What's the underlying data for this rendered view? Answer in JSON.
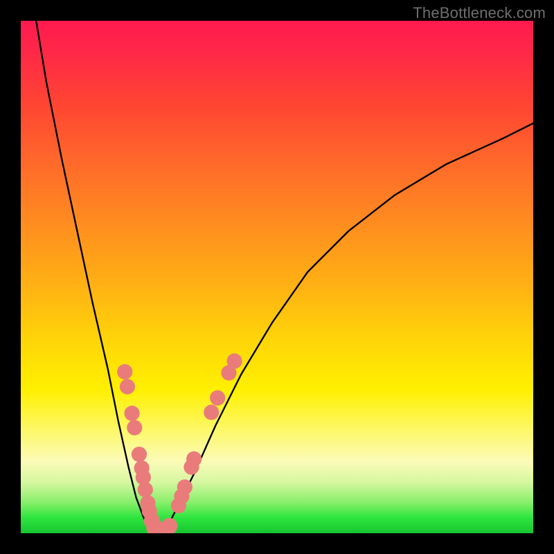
{
  "watermark": "TheBottleneck.com",
  "chart_data": {
    "type": "line",
    "title": "",
    "xlabel": "",
    "ylabel": "",
    "xlim": [
      0,
      100
    ],
    "ylim": [
      0,
      100
    ],
    "series": [
      {
        "name": "curve-left",
        "x": [
          3,
          5,
          8,
          11,
          14,
          17,
          19,
          21,
          22.5,
          24,
          25,
          25.8,
          26.6
        ],
        "y": [
          100,
          88,
          73,
          59,
          45,
          32,
          22,
          13,
          7,
          3,
          1,
          0.4,
          0.2
        ]
      },
      {
        "name": "curve-right",
        "x": [
          26.6,
          27.5,
          29,
          31,
          34,
          38,
          43,
          49,
          56,
          64,
          73,
          83,
          94,
          100
        ],
        "y": [
          0.2,
          0.5,
          2,
          6,
          12,
          21,
          31,
          41,
          51,
          59,
          66,
          72,
          77,
          80
        ]
      }
    ],
    "markers": {
      "name": "pink-dots",
      "color": "#ea7b7b",
      "points": [
        {
          "x": 20.3,
          "y": 31.5,
          "r": 1.5
        },
        {
          "x": 20.8,
          "y": 28.6,
          "r": 1.5
        },
        {
          "x": 21.7,
          "y": 23.4,
          "r": 1.5
        },
        {
          "x": 22.2,
          "y": 20.6,
          "r": 1.5
        },
        {
          "x": 23.1,
          "y": 15.4,
          "r": 1.5
        },
        {
          "x": 23.6,
          "y": 12.7,
          "r": 1.5
        },
        {
          "x": 23.9,
          "y": 10.9,
          "r": 1.5
        },
        {
          "x": 24.3,
          "y": 8.5,
          "r": 1.5
        },
        {
          "x": 24.8,
          "y": 5.9,
          "r": 1.5
        },
        {
          "x": 25.1,
          "y": 4.3,
          "r": 1.5
        },
        {
          "x": 25.6,
          "y": 2.4,
          "r": 1.6
        },
        {
          "x": 26.2,
          "y": 1.0,
          "r": 1.7
        },
        {
          "x": 26.9,
          "y": 0.45,
          "r": 1.7
        },
        {
          "x": 27.7,
          "y": 0.45,
          "r": 1.7
        },
        {
          "x": 28.4,
          "y": 0.7,
          "r": 1.7
        },
        {
          "x": 29.0,
          "y": 1.4,
          "r": 1.6
        },
        {
          "x": 30.8,
          "y": 5.4,
          "r": 1.5
        },
        {
          "x": 31.4,
          "y": 7.2,
          "r": 1.5
        },
        {
          "x": 32.0,
          "y": 9.0,
          "r": 1.5
        },
        {
          "x": 33.3,
          "y": 12.9,
          "r": 1.5
        },
        {
          "x": 33.8,
          "y": 14.5,
          "r": 1.5
        },
        {
          "x": 37.2,
          "y": 23.6,
          "r": 1.5
        },
        {
          "x": 38.4,
          "y": 26.4,
          "r": 1.5
        },
        {
          "x": 40.6,
          "y": 31.3,
          "r": 1.5
        },
        {
          "x": 41.7,
          "y": 33.6,
          "r": 1.5
        }
      ]
    }
  }
}
